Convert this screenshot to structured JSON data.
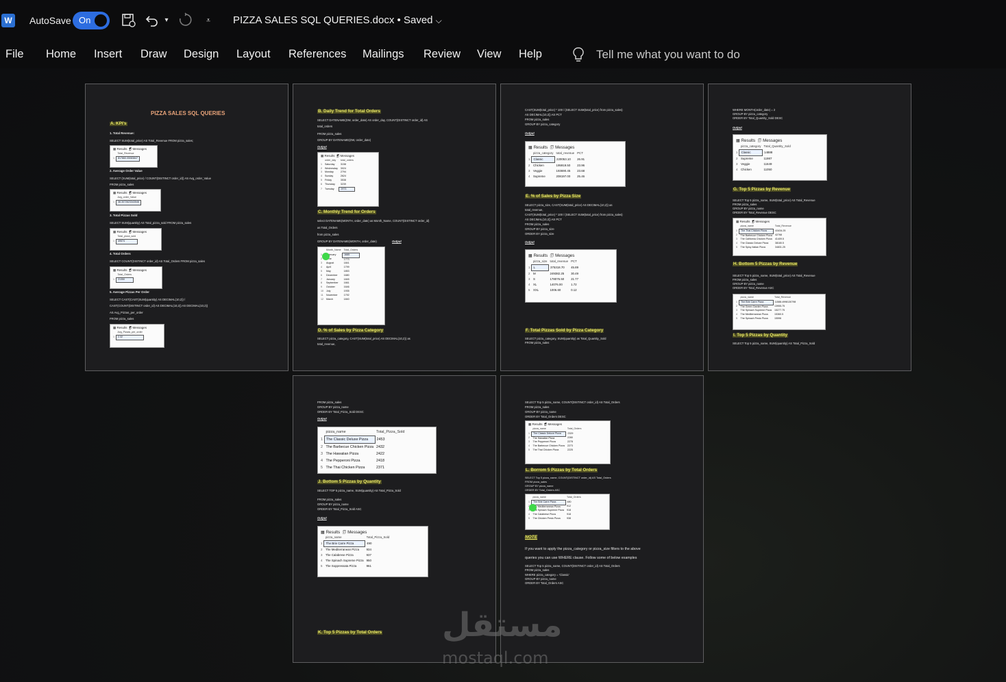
{
  "window": {
    "autosave_label": "AutoSave",
    "autosave_state": "On",
    "doc_title": "PIZZA SALES SQL QUERIES.docx",
    "doc_status": "• Saved",
    "word_icon": "W"
  },
  "menu": {
    "items": [
      "File",
      "Home",
      "Insert",
      "Draw",
      "Design",
      "Layout",
      "References",
      "Mailings",
      "Review",
      "View",
      "Help"
    ],
    "tell_me": "Tell me what you want to do"
  },
  "page1": {
    "title": "PIZZA SALES SQL QUERIES",
    "heading_kpi": "A. KPI’s",
    "q1": "1. Total Revenue:",
    "q1_code": "SELECT SUM(total_price) AS Total_Revenue FROM pizza_sales;",
    "r1_header": "Total_Revenue",
    "r1_value": "817860.05083847",
    "q2": "2. Average Order Value",
    "q2_code1": "SELECT (SUM(total_price) / COUNT(DISTINCT order_id)) AS Avg_order_Value",
    "q2_code2": "FROM pizza_sales",
    "r2_header": "Avg_order_Value",
    "r2_value": "38.3072623343546",
    "q3": "3. Total Pizzas Sold",
    "q3_code": "SELECT SUM(quantity) AS Total_pizza_sold FROM pizza_sales",
    "r3_header": "Total_pizza_sold",
    "r3_value": "49574",
    "q4": "4. Total Orders",
    "q4_code": "SELECT COUNT(DISTINCT order_id) AS Total_Orders FROM pizza_sales",
    "r4_header": "Total_Orders",
    "r4_value": "21350",
    "q5": "5. Average Pizzas Per Order",
    "q5_code1": "SELECT CAST(CAST(SUM(quantity) AS DECIMAL(10,2)) /",
    "q5_code2": "CAST(COUNT(DISTINCT order_id) AS DECIMAL(10,2)) AS DECIMAL(10,2))",
    "q5_code3": "AS Avg_Pizzas_per_order",
    "q5_code4": "FROM pizza_sales",
    "r5_header": "Avg_Pizzas_per_order",
    "r5_value": "2.32"
  },
  "results": {
    "results_tab": "Results",
    "messages_tab": "Messages",
    "output_label": "Output"
  },
  "page2": {
    "heading_b": "B. Daily Trend for Total Orders",
    "b_code1": "SELECT DATENAME(DW, order_date) AS order_day, COUNT(DISTINCT order_id) AS",
    "b_code2": "total_orders",
    "b_code3": "FROM pizza_sales",
    "b_code4": "GROUP BY DATENAME(DW, order_date)",
    "daily_cols": [
      "order_day",
      "total_orders"
    ],
    "daily_rows": [
      [
        "Saturday",
        "3158"
      ],
      [
        "Wednesday",
        "3024"
      ],
      [
        "Monday",
        "2794"
      ],
      [
        "Sunday",
        "2624"
      ],
      [
        "Friday",
        "3538"
      ],
      [
        "Thursday",
        "3239"
      ],
      [
        "Tuesday",
        "2973"
      ]
    ],
    "heading_c": "C. Monthly Trend for Orders",
    "c_code1": "select DATENAME(MONTH, order_date) as Month_Name, COUNT(DISTINCT order_id)",
    "c_code2": "as Total_Orders",
    "c_code3": "from pizza_sales",
    "c_code4": "GROUP BY DATENAME(MONTH, order_date)",
    "monthly_cols": [
      "Month_Name",
      "Total_Orders"
    ],
    "monthly_rows": [
      [
        "February",
        "1685"
      ],
      [
        "June",
        "1773"
      ],
      [
        "August",
        "1841"
      ],
      [
        "April",
        "1799"
      ],
      [
        "May",
        "1853"
      ],
      [
        "December",
        "1680"
      ],
      [
        "January",
        "1845"
      ],
      [
        "September",
        "1661"
      ],
      [
        "October",
        "1646"
      ],
      [
        "July",
        "1935"
      ],
      [
        "November",
        "1792"
      ],
      [
        "March",
        "1840"
      ]
    ],
    "heading_d": "D. % of Sales by Pizza Category",
    "d_code1": "SELECT pizza_category, CAST(SUM(total_price) AS DECIMAL(10,2)) as",
    "d_code2": "total_revenue,"
  },
  "page3": {
    "code1": "CAST(SUM(total_price) * 100 / (SELECT SUM(total_price) from pizza_sales)",
    "code2": "AS DECIMAL(10,2)) AS PCT",
    "code3": "FROM pizza_sales",
    "code4": "GROUP BY pizza_category",
    "cat_cols": [
      "pizza_category",
      "total_revenue",
      "PCT"
    ],
    "cat_rows": [
      [
        "Classic",
        "220053.10",
        "26.91"
      ],
      [
        "Chicken",
        "195919.50",
        "23.96"
      ],
      [
        "Veggie",
        "193690.45",
        "23.68"
      ],
      [
        "Supreme",
        "208197.00",
        "25.46"
      ]
    ],
    "heading_e": "E. % of Sales by Pizza Size",
    "e_code1": "SELECT pizza_size, CAST(SUM(total_price) AS DECIMAL(10,2)) as",
    "e_code2": "total_revenue,",
    "e_code3": "CAST(SUM(total_price) * 100 / (SELECT SUM(total_price) from pizza_sales)",
    "e_code4": "AS DECIMAL(10,2)) AS PCT",
    "e_code5": "FROM pizza_sales",
    "e_code6": "GROUP BY pizza_size",
    "e_code7": "ORDER BY pizza_size",
    "size_cols": [
      "pizza_size",
      "total_revenue",
      "PCT"
    ],
    "size_rows": [
      [
        "L",
        "375318.70",
        "45.89"
      ],
      [
        "M",
        "249382.25",
        "30.49"
      ],
      [
        "S",
        "178076.50",
        "21.77"
      ],
      [
        "XL",
        "14076.00",
        "1.72"
      ],
      [
        "XXL",
        "1006.60",
        "0.12"
      ]
    ],
    "heading_f": "F. Total Pizzas Sold by Pizza Category",
    "f_code1": "SELECT pizza_category, SUM(quantity) as Total_Quantity_Sold",
    "f_code2": "FROM pizza_sales"
  },
  "page4": {
    "code1": "WHERE MONTH(order_date) = 2",
    "code2": "GROUP BY pizza_category",
    "code3": "ORDER BY Total_Quantity_Sold DESC",
    "qty_cols": [
      "pizza_category",
      "Total_Quantity_Sold"
    ],
    "qty_rows": [
      [
        "Classic",
        "14888"
      ],
      [
        "Supreme",
        "11987"
      ],
      [
        "Veggie",
        "11649"
      ],
      [
        "Chicken",
        "11050"
      ]
    ],
    "heading_g": "G. Top 5 Pizzas by Revenue",
    "g_code1": "SELECT Top 5 pizza_name, SUM(total_price) AS Total_Revenue",
    "g_code2": "FROM pizza_sales",
    "g_code3": "GROUP BY pizza_name",
    "g_code4": "ORDER BY Total_Revenue DESC",
    "top_rev_cols": [
      "pizza_name",
      "Total_Revenue"
    ],
    "top_rev_rows": [
      [
        "The Thai Chicken Pizza",
        "43434.25"
      ],
      [
        "The Barbecue Chicken Pizza",
        "42768"
      ],
      [
        "The California Chicken Pizza",
        "41409.5"
      ],
      [
        "The Classic Deluxe Pizza",
        "38180.5"
      ],
      [
        "The Spicy Italian Pizza",
        "34831.25"
      ]
    ],
    "heading_h": "H. Bottom 5 Pizzas by Revenue",
    "h_code1": "SELECT Top 5 pizza_name, SUM(total_price) AS Total_Revenue",
    "h_code2": "FROM pizza_sales",
    "h_code3": "GROUP BY pizza_name",
    "h_code4": "ORDER BY Total_Revenue ASC",
    "bot_rev_cols": [
      "pizza_name",
      "Total_Revenue"
    ],
    "bot_rev_rows": [
      [
        "The Brie Carre Pizza",
        "11588.4998130798"
      ],
      [
        "The Green Garden Pizza",
        "13955.75"
      ],
      [
        "The Spinach Supreme Pizza",
        "15277.75"
      ],
      [
        "The Mediterranean Pizza",
        "15360.5"
      ],
      [
        "The Spinach Pesto Pizza",
        "15596"
      ]
    ],
    "heading_i": "I. Top 5 Pizzas by Quantity",
    "i_code": "SELECT Top 5 pizza_name, SUM(quantity) AS Total_Pizza_Sold"
  },
  "page5": {
    "code1": "FROM pizza_sales",
    "code2": "GROUP BY pizza_name",
    "code3": "ORDER BY Total_Pizza_Sold DESC",
    "top_qty_cols": [
      "pizza_name",
      "Total_Pizza_Sold"
    ],
    "top_qty_rows": [
      [
        "The Classic Deluxe Pizza",
        "2453"
      ],
      [
        "The Barbecue Chicken Pizza",
        "2432"
      ],
      [
        "The Hawaiian Pizza",
        "2422"
      ],
      [
        "The Pepperoni Pizza",
        "2418"
      ],
      [
        "The Thai Chicken Pizza",
        "2371"
      ]
    ],
    "heading_j": "J. Bottom 5 Pizzas by Quantity",
    "j_code1": "SELECT TOP 5 pizza_name, SUM(quantity) AS Total_Pizza_Sold",
    "j_code2": "FROM pizza_sales",
    "j_code3": "GROUP BY pizza_name",
    "j_code4": "ORDER BY Total_Pizza_Sold ASC",
    "bot_qty_cols": [
      "pizza_name",
      "Total_Pizza_Sold"
    ],
    "bot_qty_rows": [
      [
        "The Brie Carre Pizza",
        "490"
      ],
      [
        "The Mediterranean Pizza",
        "934"
      ],
      [
        "The Calabrese Pizza",
        "937"
      ],
      [
        "The Spinach Supreme Pizza",
        "950"
      ],
      [
        "The Soppressata Pizza",
        "961"
      ]
    ],
    "heading_k": "K. Top 5 Pizzas by Total Orders"
  },
  "page6": {
    "code1": "SELECT Top 5 pizza_name, COUNT(DISTINCT order_id) AS Total_Orders",
    "code2": "FROM pizza_sales",
    "code3": "GROUP BY pizza_name",
    "code4": "ORDER BY Total_Orders DESC",
    "top_ord_cols": [
      "pizza_name",
      "Total_Orders"
    ],
    "top_ord_rows": [
      [
        "The Classic Deluxe Pizza",
        "2329"
      ],
      [
        "The Hawaiian Pizza",
        "2280"
      ],
      [
        "The Pepperoni Pizza",
        "2278"
      ],
      [
        "The Barbecue Chicken Pizza",
        "2273"
      ],
      [
        "The Thai Chicken Pizza",
        "2225"
      ]
    ],
    "heading_l": "L. Borrom 5 Pizzas by Total Orders",
    "l_code1": "SELECT Top 5 pizza_name, COUNT(DISTINCT order_id) AS Total_Orders",
    "l_code2": "FROM pizza_sales",
    "l_code3": "GROUP BY pizza_name",
    "l_code4": "ORDER BY Total_Orders ASC",
    "bot_ord_cols": [
      "pizza_name",
      "Total_Orders"
    ],
    "bot_ord_rows": [
      [
        "The Brie Carre Pizza",
        "480"
      ],
      [
        "The Mediterranean Pizza",
        "912"
      ],
      [
        "The Spinach Supreme Pizza",
        "918"
      ],
      [
        "The Calabrese Pizza",
        "918"
      ],
      [
        "The Chicken Pesto Pizza",
        "938"
      ]
    ],
    "note_label": "NOTE",
    "note_line1": "If you want to apply the pizza_category or pizza_size filters to the above",
    "note_line2": "queries you can use WHERE clause. Follow some of below examples",
    "ex_code1": "SELECT Top 5 pizza_name, COUNT(DISTINCT order_id) AS Total_Orders",
    "ex_code2": "FROM pizza_sales",
    "ex_code3": "WHERE pizza_category = 'Classic'",
    "ex_code4": "GROUP BY pizza_name",
    "ex_code5": "ORDER BY Total_Orders ASC"
  },
  "watermark": {
    "arabic": "مستقل",
    "latin": "mostaql.com"
  }
}
